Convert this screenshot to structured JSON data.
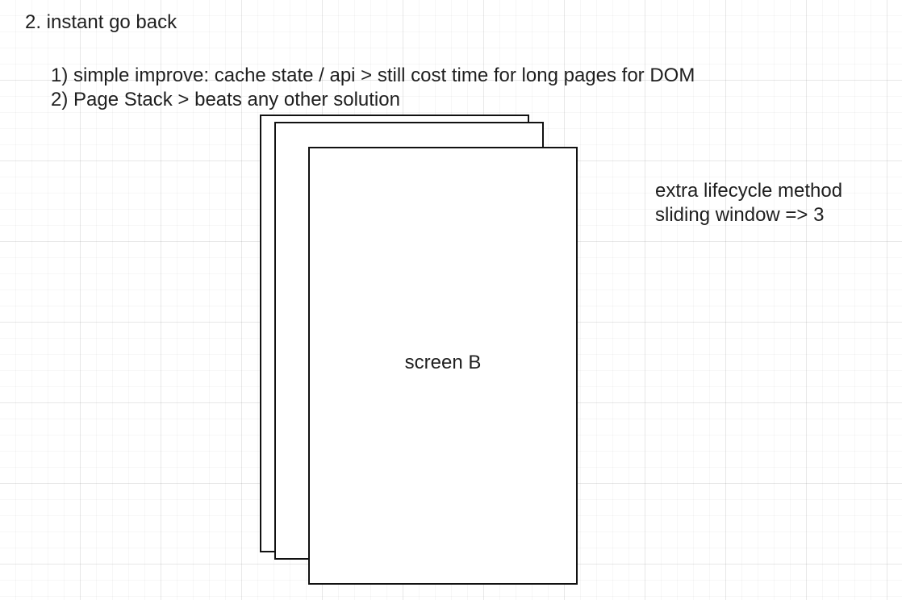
{
  "heading": "2. instant go back",
  "options": [
    "1)  simple improve: cache state / api > still cost time for long pages for DOM",
    "2) Page Stack > beats any other solution"
  ],
  "side_note": {
    "line1": "extra lifecycle method",
    "line2": "sliding window => 3"
  },
  "stack": {
    "front_label": "screen B"
  }
}
